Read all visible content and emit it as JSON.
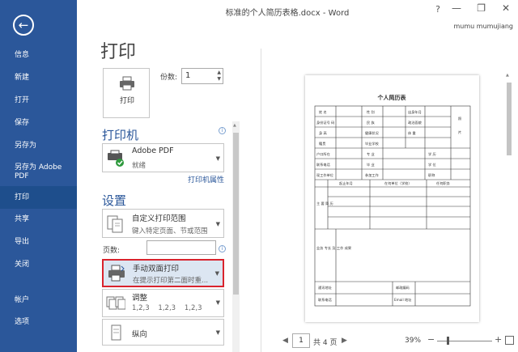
{
  "window": {
    "title": "标准的个人简历表格.docx - Word",
    "help": "?",
    "minimize": "—",
    "restore": "❐",
    "close": "✕",
    "user": "mumu mumujiang"
  },
  "nav": {
    "back_icon": "back-arrow-icon",
    "items": [
      "信息",
      "新建",
      "打开",
      "保存",
      "另存为",
      "另存为 Adobe PDF",
      "打印",
      "共享",
      "导出",
      "关闭",
      "帐户",
      "选项"
    ],
    "active_index": 6
  },
  "print": {
    "title": "打印",
    "button_label": "打印",
    "copies_label": "份数:",
    "copies_value": "1"
  },
  "printer": {
    "heading": "打印机",
    "name": "Adobe PDF",
    "status": "就绪",
    "properties_link": "打印机属性"
  },
  "settings": {
    "heading": "设置",
    "range_main": "自定义打印范围",
    "range_sub": "键入特定页面、节或范围",
    "pages_label": "页数:",
    "pages_value": "",
    "duplex_main": "手动双面打印",
    "duplex_sub": "在提示打印第二面时重...",
    "collate_main": "调整",
    "collate_sub": "1,2,3    1,2,3    1,2,3",
    "orientation_main": "纵向"
  },
  "preview": {
    "doc_title": "个人简历表",
    "cells": {
      "name": "姓 名",
      "sex": "性 别",
      "birth": "出身年月",
      "photo": "照",
      "photo2": "片",
      "id": "身份证号 码",
      "nation": "民 族",
      "politics": "政治面貌",
      "height": "身 高",
      "health": "健康状况",
      "weight": "体 重",
      "origin": "籍贯",
      "school_grad": "毕业学校",
      "major": "专 业",
      "edu": "学 历",
      "phone": "联系电话",
      "degree": "学 位",
      "current": "现工作单位",
      "work_date": "参加工作",
      "title_job": "职称",
      "row2_1": "户口所在",
      "row2_2": "毕 业",
      "row2_3": "技术",
      "study_1": "起止年月",
      "study_2": "在何单位（学校）",
      "study_3": "任何职务",
      "resume_label": "主 要 简 历",
      "work_label": "业务 专长 及 工作 成果",
      "addr": "通讯地址",
      "zip": "邮政编码",
      "contact": "联系电话",
      "email": "Email 地址"
    }
  },
  "bottom": {
    "prev": "◀",
    "page_value": "1",
    "page_total": "共 4 页",
    "next": "▶",
    "zoom": "39%",
    "zoom_minus": "−",
    "zoom_plus": "+"
  }
}
